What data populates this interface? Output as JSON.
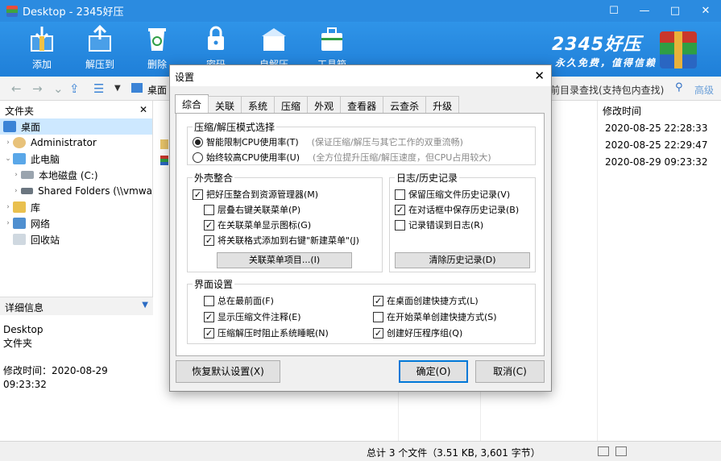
{
  "window": {
    "title": "Desktop - 2345好压",
    "controls": [
      "☐",
      "—",
      "□",
      "✕"
    ]
  },
  "toolbar": {
    "items": [
      {
        "label": "添加",
        "icon": "add-archive-icon"
      },
      {
        "label": "解压到",
        "icon": "extract-to-icon"
      },
      {
        "label": "删除",
        "icon": "recycle-bin-icon"
      },
      {
        "label": "密码",
        "icon": "lock-icon"
      },
      {
        "label": "自解压",
        "icon": "self-extract-icon"
      },
      {
        "label": "工具箱",
        "icon": "toolbox-icon"
      }
    ],
    "brand": "2345好压",
    "slogan": "永久免费，值得信赖"
  },
  "address_bar": {
    "path": "桌面",
    "search_placeholder": "前目录查找(支持包内查找)",
    "advanced": "高级"
  },
  "folder_pane": {
    "title": "文件夹",
    "close": "✕",
    "items": [
      {
        "label": "桌面",
        "icon": "desktop-icon",
        "selected": true
      },
      {
        "label": "Administrator",
        "icon": "user-icon"
      },
      {
        "label": "此电脑",
        "icon": "computer-icon"
      },
      {
        "label": "本地磁盘 (C:)",
        "icon": "disk-icon"
      },
      {
        "label": "Shared Folders (\\\\vmwa",
        "icon": "network-drive-icon"
      },
      {
        "label": "库",
        "icon": "library-icon"
      },
      {
        "label": "网络",
        "icon": "network-icon"
      },
      {
        "label": "回收站",
        "icon": "recycle-bin-icon"
      }
    ]
  },
  "details_pane": {
    "title": "详细信息",
    "name": "Desktop",
    "type": "文件夹",
    "modified": "修改时间：2020-08-29 09:23:32"
  },
  "file_list": {
    "column_modified": "修改时间",
    "dates": [
      "2020-08-25 22:28:33",
      "2020-08-25 22:29:47",
      "2020-08-29 09:23:32"
    ]
  },
  "status": {
    "text": "总计 3 个文件（3.51 KB, 3,601 字节）"
  },
  "dialog": {
    "title": "设置",
    "close": "✕",
    "tabs": [
      "综合",
      "关联",
      "系统",
      "压缩",
      "外观",
      "查看器",
      "云查杀",
      "升级"
    ],
    "mode_group": {
      "legend": "压缩/解压模式选择",
      "options": [
        {
          "label": "智能限制CPU使用率(T)",
          "hint": "(保证压缩/解压与其它工作的双重流畅)",
          "checked": true
        },
        {
          "label": "始终较高CPU使用率(U)",
          "hint": "(全方位提升压缩/解压速度，但CPU占用较大)",
          "checked": false
        }
      ]
    },
    "shell_group": {
      "legend": "外壳整合",
      "options": [
        {
          "label": "把好压整合到资源管理器(M)",
          "checked": true
        },
        {
          "label": "层叠右键关联菜单(P)",
          "checked": false
        },
        {
          "label": "在关联菜单显示图标(G)",
          "checked": true
        },
        {
          "label": "将关联格式添加到右键\"新建菜单\"(J)",
          "checked": true
        }
      ],
      "button": "关联菜单项目...(I)"
    },
    "log_group": {
      "legend": "日志/历史记录",
      "options": [
        {
          "label": "保留压缩文件历史记录(V)",
          "checked": false
        },
        {
          "label": "在对话框中保存历史记录(B)",
          "checked": true
        },
        {
          "label": "记录错误到日志(R)",
          "checked": false
        }
      ],
      "button": "清除历史记录(D)"
    },
    "ui_group": {
      "legend": "界面设置",
      "left": [
        {
          "label": "总在最前面(F)",
          "checked": false
        },
        {
          "label": "显示压缩文件注释(E)",
          "checked": true
        },
        {
          "label": "压缩解压时阻止系统睡眠(N)",
          "checked": true
        }
      ],
      "right": [
        {
          "label": "在桌面创建快捷方式(L)",
          "checked": true
        },
        {
          "label": "在开始菜单创建快捷方式(S)",
          "checked": false
        },
        {
          "label": "创建好压程序组(Q)",
          "checked": true
        }
      ]
    },
    "buttons": {
      "reset": "恢复默认设置(X)",
      "ok": "确定(O)",
      "cancel": "取消(C)"
    }
  },
  "check_mark": "✓"
}
